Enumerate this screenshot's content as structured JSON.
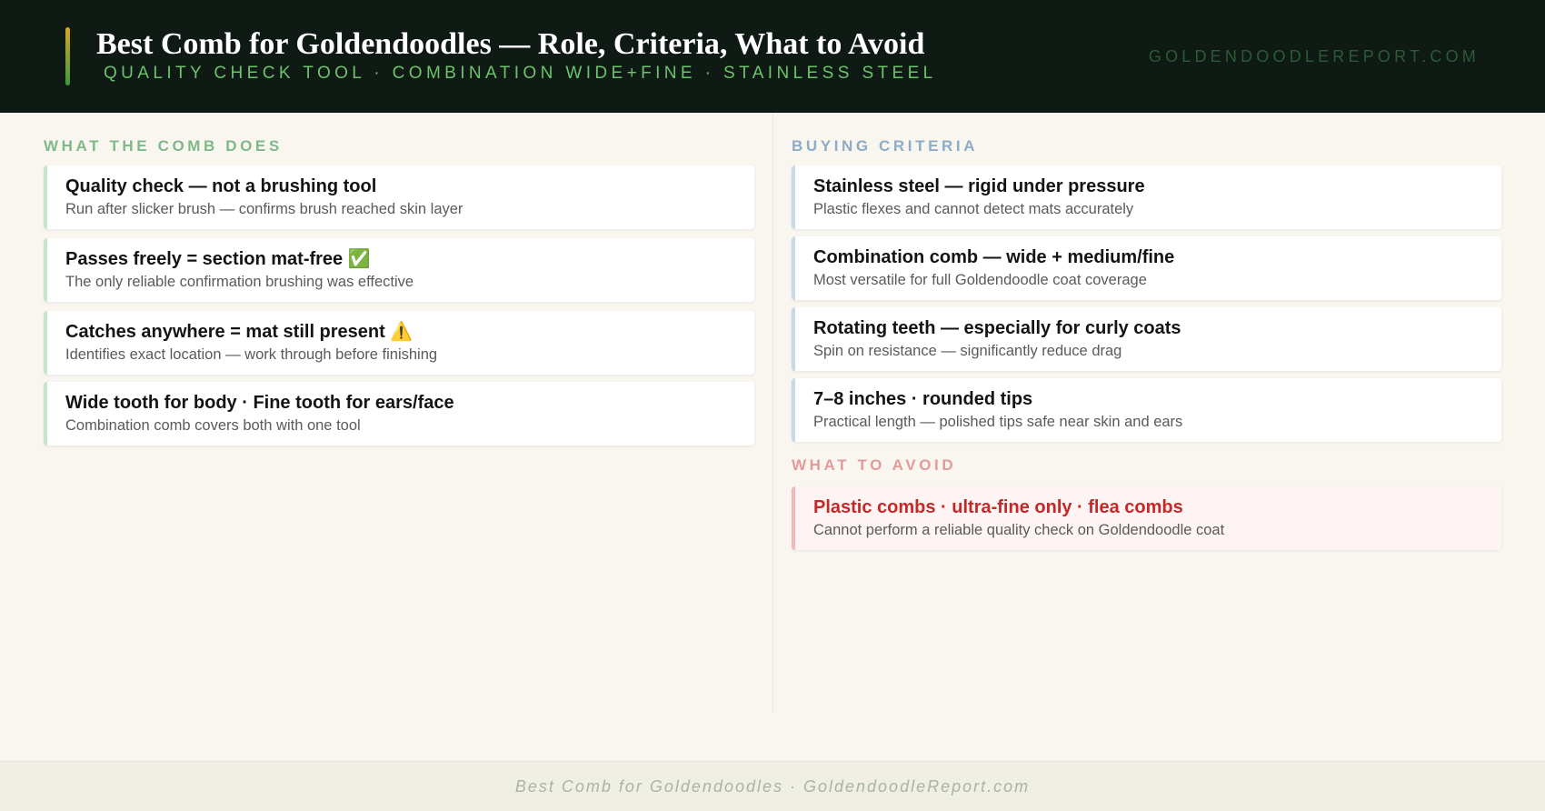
{
  "header": {
    "title": "Best Comb for Goldendoodles — Role, Criteria, What to Avoid",
    "subtitle": "QUALITY CHECK TOOL · COMBINATION WIDE+FINE · STAINLESS STEEL",
    "site": "GOLDENDOODLEREPORT.COM"
  },
  "left": {
    "label": "WHAT THE COMB DOES",
    "items": [
      {
        "title": "Quality check — not a brushing tool",
        "emoji": "",
        "desc": "Run after slicker brush — confirms brush reached skin layer"
      },
      {
        "title": "Passes freely = section mat-free ",
        "emoji": "✅",
        "desc": "The only reliable confirmation brushing was effective"
      },
      {
        "title": "Catches anywhere = mat still present ",
        "emoji": "⚠️",
        "desc": "Identifies exact location — work through before finishing"
      },
      {
        "title": "Wide tooth for body · Fine tooth for ears/face",
        "emoji": "",
        "desc": "Combination comb covers both with one tool"
      }
    ]
  },
  "right": {
    "label": "BUYING CRITERIA",
    "items": [
      {
        "title": "Stainless steel — rigid under pressure",
        "desc": "Plastic flexes and cannot detect mats accurately"
      },
      {
        "title": "Combination comb — wide + medium/fine",
        "desc": "Most versatile for full Goldendoodle coat coverage"
      },
      {
        "title": "Rotating teeth — especially for curly coats",
        "desc": "Spin on resistance — significantly reduce drag"
      },
      {
        "title": "7–8 inches · rounded tips",
        "desc": "Practical length — polished tips safe near skin and ears"
      }
    ],
    "avoid_label": "WHAT TO AVOID",
    "avoid": {
      "title": "Plastic combs · ultra-fine only · flea combs",
      "desc": "Cannot perform a reliable quality check on Goldendoodle coat"
    }
  },
  "footer": {
    "text": "Best Comb for Goldendoodles · GoldendoodleReport.com"
  },
  "colors": {
    "header_bg": "#0f1a14",
    "accent_green": "#6bc46b",
    "page_bg": "#f9f6f0",
    "avoid_red": "#c62828"
  }
}
